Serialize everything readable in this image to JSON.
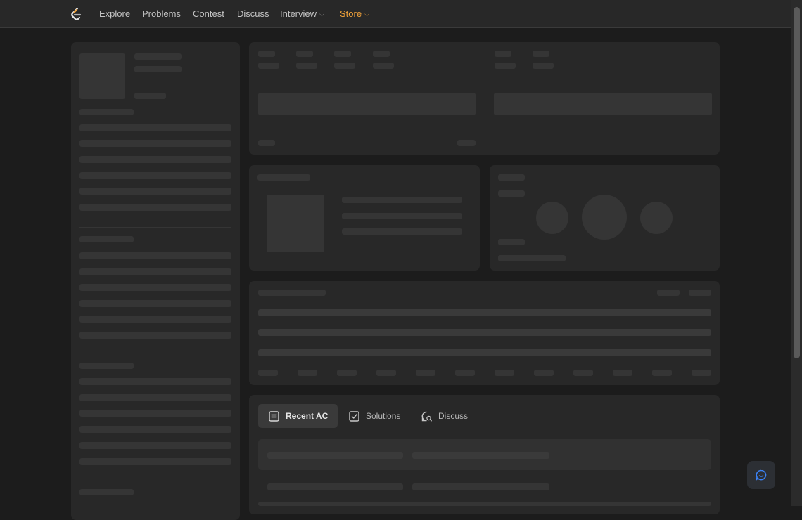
{
  "nav": {
    "items": [
      "Explore",
      "Problems",
      "Contest",
      "Discuss",
      "Interview",
      "Store"
    ],
    "accent_color": "#f0a23a"
  },
  "tabs": {
    "recent_ac": "Recent AC",
    "solutions": "Solutions",
    "discuss": "Discuss"
  },
  "icons": {
    "logo": "leetcode-logo-icon",
    "recent_ac": "list-doc-icon",
    "solutions": "checkbox-icon",
    "discuss": "chat-search-icon",
    "float": "chat-bubble-icon"
  },
  "state": "loading-skeleton"
}
